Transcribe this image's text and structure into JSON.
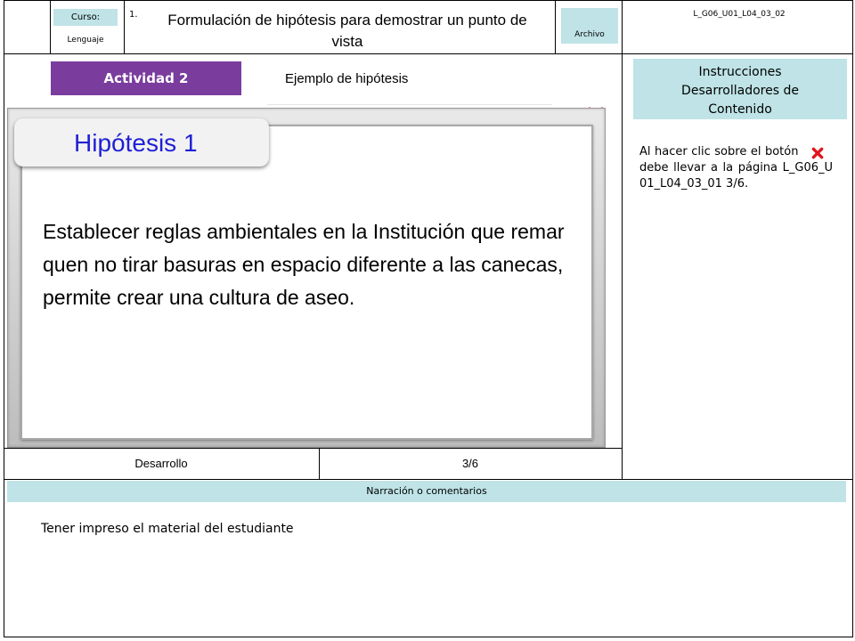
{
  "header": {
    "curso_label": "Curso:",
    "curso_value": "Lenguaje",
    "item_number": "1.",
    "title": "Formulación de hipótesis para demostrar un punto de vista",
    "archivo_label": "Archivo",
    "code": "L_G06_U01_L04_03_02"
  },
  "activity": {
    "badge": "Actividad 2",
    "subtitle": "Ejemplo de hipótesis"
  },
  "card": {
    "tab_title": "Hipótesis 1",
    "body_text": "Establecer reglas ambientales en la Institución que remarquen no tirar basuras en espacio diferente a las canecas, permite crear una cultura de aseo."
  },
  "instructions": {
    "heading": "Instrucciones Desarrolladores de Contenido",
    "text_before": "Al hacer clic sobre el botón",
    "text_after": "debe llevar a la página L_G06_U01_L04_03_01 3/6."
  },
  "footer_row": {
    "section": "Desarrollo",
    "page": "3/6"
  },
  "narration": {
    "heading": "Narración o comentarios",
    "text": "Tener impreso el material del estudiante"
  },
  "colors": {
    "badge_purple": "#7a3d9e",
    "cell_cyan": "#bfe3e6",
    "close_red": "#e0141c",
    "tab_blue": "#1f1fd6"
  }
}
